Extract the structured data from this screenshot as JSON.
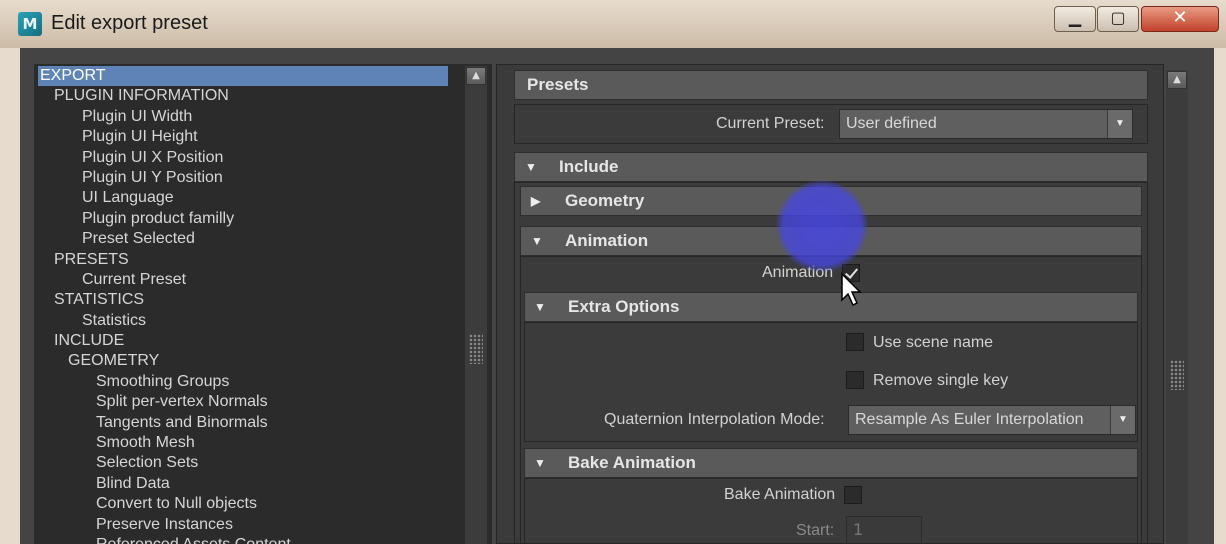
{
  "window": {
    "title": "Edit export preset"
  },
  "tree": {
    "items": [
      {
        "label": "EXPORT",
        "level": 0,
        "selected": true
      },
      {
        "label": "PLUGIN INFORMATION",
        "level": 1
      },
      {
        "label": "Plugin UI Width",
        "level": 2
      },
      {
        "label": "Plugin UI Height",
        "level": 2
      },
      {
        "label": "Plugin UI X Position",
        "level": 2
      },
      {
        "label": "Plugin UI Y Position",
        "level": 2
      },
      {
        "label": "UI Language",
        "level": 2
      },
      {
        "label": "Plugin product familly",
        "level": 2
      },
      {
        "label": "Preset Selected",
        "level": 2
      },
      {
        "label": "PRESETS",
        "level": 1
      },
      {
        "label": "Current Preset",
        "level": 2
      },
      {
        "label": "STATISTICS",
        "level": 1
      },
      {
        "label": "Statistics",
        "level": 2
      },
      {
        "label": "INCLUDE",
        "level": 1
      },
      {
        "label": "GEOMETRY",
        "level": "1g"
      },
      {
        "label": "Smoothing Groups",
        "level": 3
      },
      {
        "label": "Split per-vertex Normals",
        "level": 3
      },
      {
        "label": "Tangents and Binormals",
        "level": 3
      },
      {
        "label": "Smooth Mesh",
        "level": 3
      },
      {
        "label": "Selection Sets",
        "level": 3
      },
      {
        "label": "Blind Data",
        "level": 3
      },
      {
        "label": "Convert to Null objects",
        "level": 3
      },
      {
        "label": "Preserve Instances",
        "level": 3
      },
      {
        "label": "Referenced Assets Content",
        "level": 3
      }
    ]
  },
  "presets": {
    "header": "Presets",
    "current_preset_label": "Current Preset:",
    "current_preset_value": "User defined"
  },
  "include": {
    "header": "Include",
    "geometry_header": "Geometry",
    "animation_header": "Animation",
    "animation_label": "Animation",
    "animation_checked": true,
    "extra_options": {
      "header": "Extra Options",
      "use_scene_name": "Use scene name",
      "remove_single_key": "Remove single key",
      "quaternion_label": "Quaternion Interpolation Mode:",
      "quaternion_value": "Resample As Euler Interpolation"
    },
    "bake_animation": {
      "header": "Bake Animation",
      "label": "Bake Animation",
      "start_label": "Start:",
      "start_value": "1"
    }
  }
}
